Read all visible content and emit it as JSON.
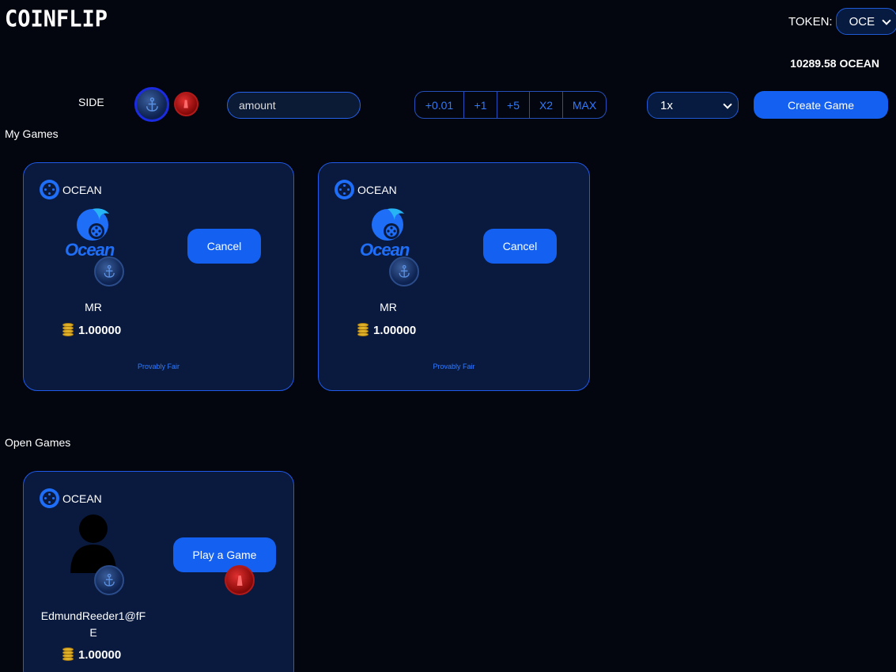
{
  "app": {
    "logo": "COINFLIP"
  },
  "header": {
    "token_label": "TOKEN:",
    "token_value": "OCE",
    "balance": "10289.58 OCEAN"
  },
  "controls": {
    "side_label": "SIDE",
    "amount_placeholder": "amount",
    "increments": [
      "+0.01",
      "+1",
      "+5",
      "X2",
      "MAX"
    ],
    "multiplier": "1x",
    "create_button": "Create Game"
  },
  "my_games": {
    "title": "My Games",
    "cards": [
      {
        "token": "OCEAN",
        "logo_text": "Ocean",
        "player": "MR",
        "amount": "1.00000",
        "button": "Cancel",
        "footer": "Provably Fair"
      },
      {
        "token": "OCEAN",
        "logo_text": "Ocean",
        "player": "MR",
        "amount": "1.00000",
        "button": "Cancel",
        "footer": "Provably Fair"
      }
    ]
  },
  "open_games": {
    "title": "Open Games",
    "cards": [
      {
        "token": "OCEAN",
        "player_line1": "EdmundReeder1@fF",
        "player_line2": "E",
        "amount": "1.00000",
        "button": "Play a Game"
      }
    ]
  },
  "colors": {
    "background": "#03060f",
    "card": "#0a1a3f",
    "accent": "#1460f0",
    "link": "#2f7bff"
  }
}
